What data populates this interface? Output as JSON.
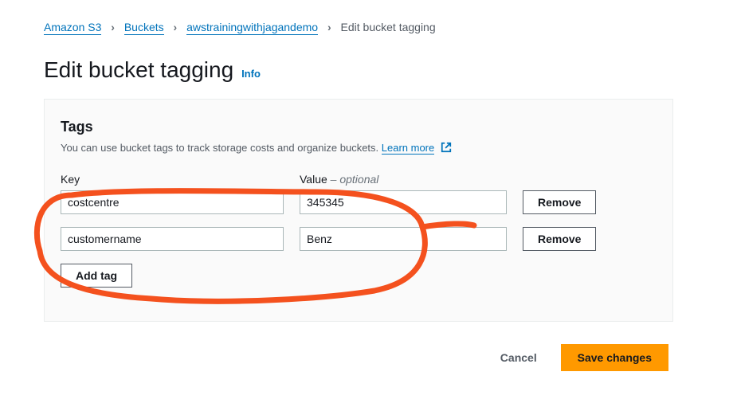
{
  "breadcrumb": {
    "items": [
      {
        "label": "Amazon S3",
        "link": true
      },
      {
        "label": "Buckets",
        "link": true
      },
      {
        "label": "awstrainingwithjagandemo",
        "link": true
      },
      {
        "label": "Edit bucket tagging",
        "link": false
      }
    ]
  },
  "page": {
    "title": "Edit bucket tagging",
    "info_label": "Info"
  },
  "panel": {
    "heading": "Tags",
    "description_prefix": "You can use bucket tags to track storage costs and organize buckets. ",
    "learn_more_label": "Learn more",
    "columns": {
      "key_label": "Key",
      "value_label": "Value",
      "value_optional": " – optional"
    },
    "rows": [
      {
        "key": "costcentre",
        "value": "345345"
      },
      {
        "key": "customername",
        "value": "Benz"
      }
    ],
    "remove_label": "Remove",
    "add_tag_label": "Add tag"
  },
  "footer": {
    "cancel_label": "Cancel",
    "save_label": "Save changes"
  },
  "colors": {
    "accent_link": "#0073bb",
    "primary_button": "#ff9900",
    "annotation": "#ff5722"
  }
}
